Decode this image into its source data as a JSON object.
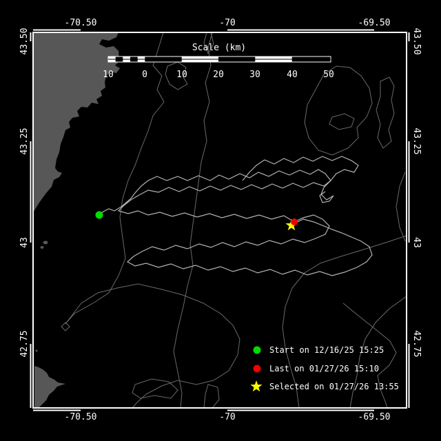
{
  "map": {
    "description": "Drifter track map, Gulf of Maine, black ocean with gray land and bathymetry contours",
    "axes": {
      "top": [
        "-70.50",
        "-70",
        "-69.50"
      ],
      "bottom": [
        "-70.50",
        "-70",
        "-69.50"
      ],
      "left": [
        "43.50",
        "43.25",
        "43",
        "42.75"
      ],
      "right": [
        "43.50",
        "43.25",
        "43",
        "42.75"
      ]
    }
  },
  "scalebar": {
    "title": "Scale (km)",
    "ticks": [
      "10",
      "0",
      "10",
      "20",
      "30",
      "40",
      "50"
    ]
  },
  "legend": {
    "start": {
      "label": "Start on 12/16/25 15:25",
      "marker": "circle-icon",
      "color": "#00dd00"
    },
    "last": {
      "label": "Last on 01/27/26 15:10",
      "marker": "circle-icon",
      "color": "#ee0000"
    },
    "selected": {
      "label": "Selected on 01/27/26 13:55",
      "marker": "star-icon",
      "color": "#ffff00"
    }
  },
  "colors": {
    "background": "#000000",
    "frame": "#ffffff",
    "land": "#575757",
    "contour": "#6a6a6a",
    "track": "#b4b4b4",
    "start": "#00dd00",
    "last": "#ee0000",
    "selected": "#ffff00"
  }
}
